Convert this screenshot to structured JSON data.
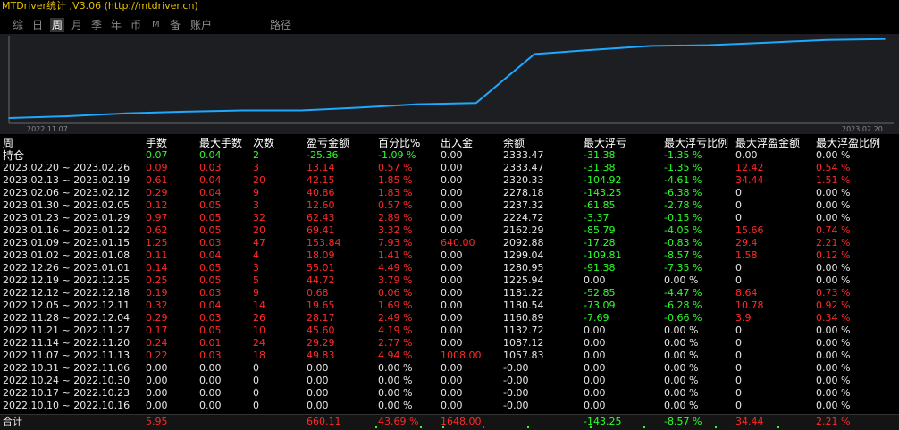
{
  "app": {
    "title": "MTDriver统计 ,V3.06 (http://mtdriver.cn)"
  },
  "tabs": [
    {
      "label": "综",
      "active": false
    },
    {
      "label": "日",
      "active": false
    },
    {
      "label": "周",
      "active": true
    },
    {
      "label": "月",
      "active": false
    },
    {
      "label": "季",
      "active": false
    },
    {
      "label": "年",
      "active": false
    },
    {
      "label": "币",
      "active": false
    },
    {
      "label": "M",
      "active": false
    },
    {
      "label": "备",
      "active": false
    },
    {
      "label": "账户",
      "active": false
    },
    {
      "label": "路径",
      "active": false
    }
  ],
  "chart": {
    "start_label": "2022.11.07",
    "end_label": "2023.02.20",
    "line_color": "#1ea8ff",
    "background": "#1c1e22"
  },
  "chart_data": {
    "type": "line",
    "x": [
      "2022.11.07",
      "2022.11.14",
      "2022.11.21",
      "2022.11.28",
      "2022.12.05",
      "2022.12.12",
      "2022.12.19",
      "2022.12.26",
      "2023.01.02",
      "2023.01.09",
      "2023.01.16",
      "2023.01.23",
      "2023.01.30",
      "2023.02.06",
      "2023.02.13",
      "2023.02.20"
    ],
    "values": [
      1057.83,
      1087.12,
      1132.72,
      1160.89,
      1180.54,
      1181.22,
      1225.94,
      1280.95,
      1299.04,
      2092.88,
      2162.29,
      2224.72,
      2237.32,
      2278.18,
      2320.33,
      2333.47
    ],
    "xlabel": "",
    "ylabel": ""
  },
  "table": {
    "headers": [
      "周",
      "手数",
      "最大手数",
      "次数",
      "盈亏金额",
      "百分比%",
      "出入金",
      "余额",
      "最大浮亏",
      "最大浮亏比例",
      "最大浮盈金额",
      "最大浮盈比例"
    ],
    "hold_row": {
      "label": "持仓",
      "cells": [
        "0.07",
        "0.04",
        "2",
        "-25.36",
        "-1.09 %",
        "0.00",
        "2333.47",
        "-31.38",
        "-1.35 %",
        "0.00",
        "0.00 %"
      ]
    },
    "rows": [
      [
        "2023.02.20 ~ 2023.02.26",
        "0.09",
        "0.03",
        "3",
        "13.14",
        "0.57 %",
        "0.00",
        "2333.47",
        "-31.38",
        "-1.35 %",
        "12.42",
        "0.54 %"
      ],
      [
        "2023.02.13 ~ 2023.02.19",
        "0.61",
        "0.04",
        "20",
        "42.15",
        "1.85 %",
        "0.00",
        "2320.33",
        "-104.92",
        "-4.61 %",
        "34.44",
        "1.51 %"
      ],
      [
        "2023.02.06 ~ 2023.02.12",
        "0.29",
        "0.04",
        "9",
        "40.86",
        "1.83 %",
        "0.00",
        "2278.18",
        "-143.25",
        "-6.38 %",
        "0",
        "0.00 %"
      ],
      [
        "2023.01.30 ~ 2023.02.05",
        "0.12",
        "0.05",
        "3",
        "12.60",
        "0.57 %",
        "0.00",
        "2237.32",
        "-61.85",
        "-2.78 %",
        "0",
        "0.00 %"
      ],
      [
        "2023.01.23 ~ 2023.01.29",
        "0.97",
        "0.05",
        "32",
        "62.43",
        "2.89 %",
        "0.00",
        "2224.72",
        "-3.37",
        "-0.15 %",
        "0",
        "0.00 %"
      ],
      [
        "2023.01.16 ~ 2023.01.22",
        "0.62",
        "0.05",
        "20",
        "69.41",
        "3.32 %",
        "0.00",
        "2162.29",
        "-85.79",
        "-4.05 %",
        "15.66",
        "0.74 %"
      ],
      [
        "2023.01.09 ~ 2023.01.15",
        "1.25",
        "0.03",
        "47",
        "153.84",
        "7.93 %",
        "640.00",
        "2092.88",
        "-17.28",
        "-0.83 %",
        "29.4",
        "2.21 %"
      ],
      [
        "2023.01.02 ~ 2023.01.08",
        "0.11",
        "0.04",
        "4",
        "18.09",
        "1.41 %",
        "0.00",
        "1299.04",
        "-109.81",
        "-8.57 %",
        "1.58",
        "0.12 %"
      ],
      [
        "2022.12.26 ~ 2023.01.01",
        "0.14",
        "0.05",
        "3",
        "55.01",
        "4.49 %",
        "0.00",
        "1280.95",
        "-91.38",
        "-7.35 %",
        "0",
        "0.00 %"
      ],
      [
        "2022.12.19 ~ 2022.12.25",
        "0.25",
        "0.05",
        "5",
        "44.72",
        "3.79 %",
        "0.00",
        "1225.94",
        "0.00",
        "0.00 %",
        "0",
        "0.00 %"
      ],
      [
        "2022.12.12 ~ 2022.12.18",
        "0.19",
        "0.03",
        "9",
        "0.68",
        "0.06 %",
        "0.00",
        "1181.22",
        "-52.85",
        "-4.47 %",
        "8.64",
        "0.73 %"
      ],
      [
        "2022.12.05 ~ 2022.12.11",
        "0.32",
        "0.04",
        "14",
        "19.65",
        "1.69 %",
        "0.00",
        "1180.54",
        "-73.09",
        "-6.28 %",
        "10.78",
        "0.92 %"
      ],
      [
        "2022.11.28 ~ 2022.12.04",
        "0.29",
        "0.03",
        "26",
        "28.17",
        "2.49 %",
        "0.00",
        "1160.89",
        "-7.69",
        "-0.66 %",
        "3.9",
        "0.34 %"
      ],
      [
        "2022.11.21 ~ 2022.11.27",
        "0.17",
        "0.05",
        "10",
        "45.60",
        "4.19 %",
        "0.00",
        "1132.72",
        "0.00",
        "0.00 %",
        "0",
        "0.00 %"
      ],
      [
        "2022.11.14 ~ 2022.11.20",
        "0.24",
        "0.01",
        "24",
        "29.29",
        "2.77 %",
        "0.00",
        "1087.12",
        "0.00",
        "0.00 %",
        "0",
        "0.00 %"
      ],
      [
        "2022.11.07 ~ 2022.11.13",
        "0.22",
        "0.03",
        "18",
        "49.83",
        "4.94 %",
        "1008.00",
        "1057.83",
        "0.00",
        "0.00 %",
        "0",
        "0.00 %"
      ],
      [
        "2022.10.31 ~ 2022.11.06",
        "0.00",
        "0.00",
        "0",
        "0.00",
        "0.00 %",
        "0.00",
        "-0.00",
        "0.00",
        "0.00 %",
        "0",
        "0.00 %"
      ],
      [
        "2022.10.24 ~ 2022.10.30",
        "0.00",
        "0.00",
        "0",
        "0.00",
        "0.00 %",
        "0.00",
        "-0.00",
        "0.00",
        "0.00 %",
        "0",
        "0.00 %"
      ],
      [
        "2022.10.17 ~ 2022.10.23",
        "0.00",
        "0.00",
        "0",
        "0.00",
        "0.00 %",
        "0.00",
        "-0.00",
        "0.00",
        "0.00 %",
        "0",
        "0.00 %"
      ],
      [
        "2022.10.10 ~ 2022.10.16",
        "0.00",
        "0.00",
        "0",
        "0.00",
        "0.00 %",
        "0.00",
        "-0.00",
        "0.00",
        "0.00 %",
        "0",
        "0.00 %"
      ]
    ],
    "row_colors": [
      [
        "r",
        "r",
        "r",
        "r",
        "r",
        "w",
        "w",
        "g",
        "g",
        "r",
        "r"
      ],
      [
        "r",
        "r",
        "r",
        "r",
        "r",
        "w",
        "w",
        "g",
        "g",
        "r",
        "r"
      ],
      [
        "r",
        "r",
        "r",
        "r",
        "r",
        "w",
        "w",
        "g",
        "g",
        "w",
        "w"
      ],
      [
        "r",
        "r",
        "r",
        "r",
        "r",
        "w",
        "w",
        "g",
        "g",
        "w",
        "w"
      ],
      [
        "r",
        "r",
        "r",
        "r",
        "r",
        "w",
        "w",
        "g",
        "g",
        "w",
        "w"
      ],
      [
        "r",
        "r",
        "r",
        "r",
        "r",
        "w",
        "w",
        "g",
        "g",
        "r",
        "r"
      ],
      [
        "r",
        "r",
        "r",
        "r",
        "r",
        "r",
        "w",
        "g",
        "g",
        "r",
        "r"
      ],
      [
        "r",
        "r",
        "r",
        "r",
        "r",
        "w",
        "w",
        "g",
        "g",
        "r",
        "r"
      ],
      [
        "r",
        "r",
        "r",
        "r",
        "r",
        "w",
        "w",
        "g",
        "g",
        "w",
        "w"
      ],
      [
        "r",
        "r",
        "r",
        "r",
        "r",
        "w",
        "w",
        "w",
        "w",
        "w",
        "w"
      ],
      [
        "r",
        "r",
        "r",
        "r",
        "r",
        "w",
        "w",
        "g",
        "g",
        "r",
        "r"
      ],
      [
        "r",
        "r",
        "r",
        "r",
        "r",
        "w",
        "w",
        "g",
        "g",
        "r",
        "r"
      ],
      [
        "r",
        "r",
        "r",
        "r",
        "r",
        "w",
        "w",
        "g",
        "g",
        "r",
        "r"
      ],
      [
        "r",
        "r",
        "r",
        "r",
        "r",
        "w",
        "w",
        "w",
        "w",
        "w",
        "w"
      ],
      [
        "r",
        "r",
        "r",
        "r",
        "r",
        "w",
        "w",
        "w",
        "w",
        "w",
        "w"
      ],
      [
        "r",
        "r",
        "r",
        "r",
        "r",
        "r",
        "w",
        "w",
        "w",
        "w",
        "w"
      ],
      [
        "w",
        "w",
        "w",
        "w",
        "w",
        "w",
        "w",
        "w",
        "w",
        "w",
        "w"
      ],
      [
        "w",
        "w",
        "w",
        "w",
        "w",
        "w",
        "w",
        "w",
        "w",
        "w",
        "w"
      ],
      [
        "w",
        "w",
        "w",
        "w",
        "w",
        "w",
        "w",
        "w",
        "w",
        "w",
        "w"
      ],
      [
        "w",
        "w",
        "w",
        "w",
        "w",
        "w",
        "w",
        "w",
        "w",
        "w",
        "w"
      ]
    ],
    "total": {
      "label": "合计",
      "lots": "5.95",
      "profit": "660.11",
      "percent": "43.69 %",
      "deposit": "1648.00",
      "max_float_loss": "-143.25",
      "max_float_loss_pct": "-8.57 %",
      "max_float_profit": "34.44",
      "max_float_profit_pct": "2.21 %"
    }
  }
}
